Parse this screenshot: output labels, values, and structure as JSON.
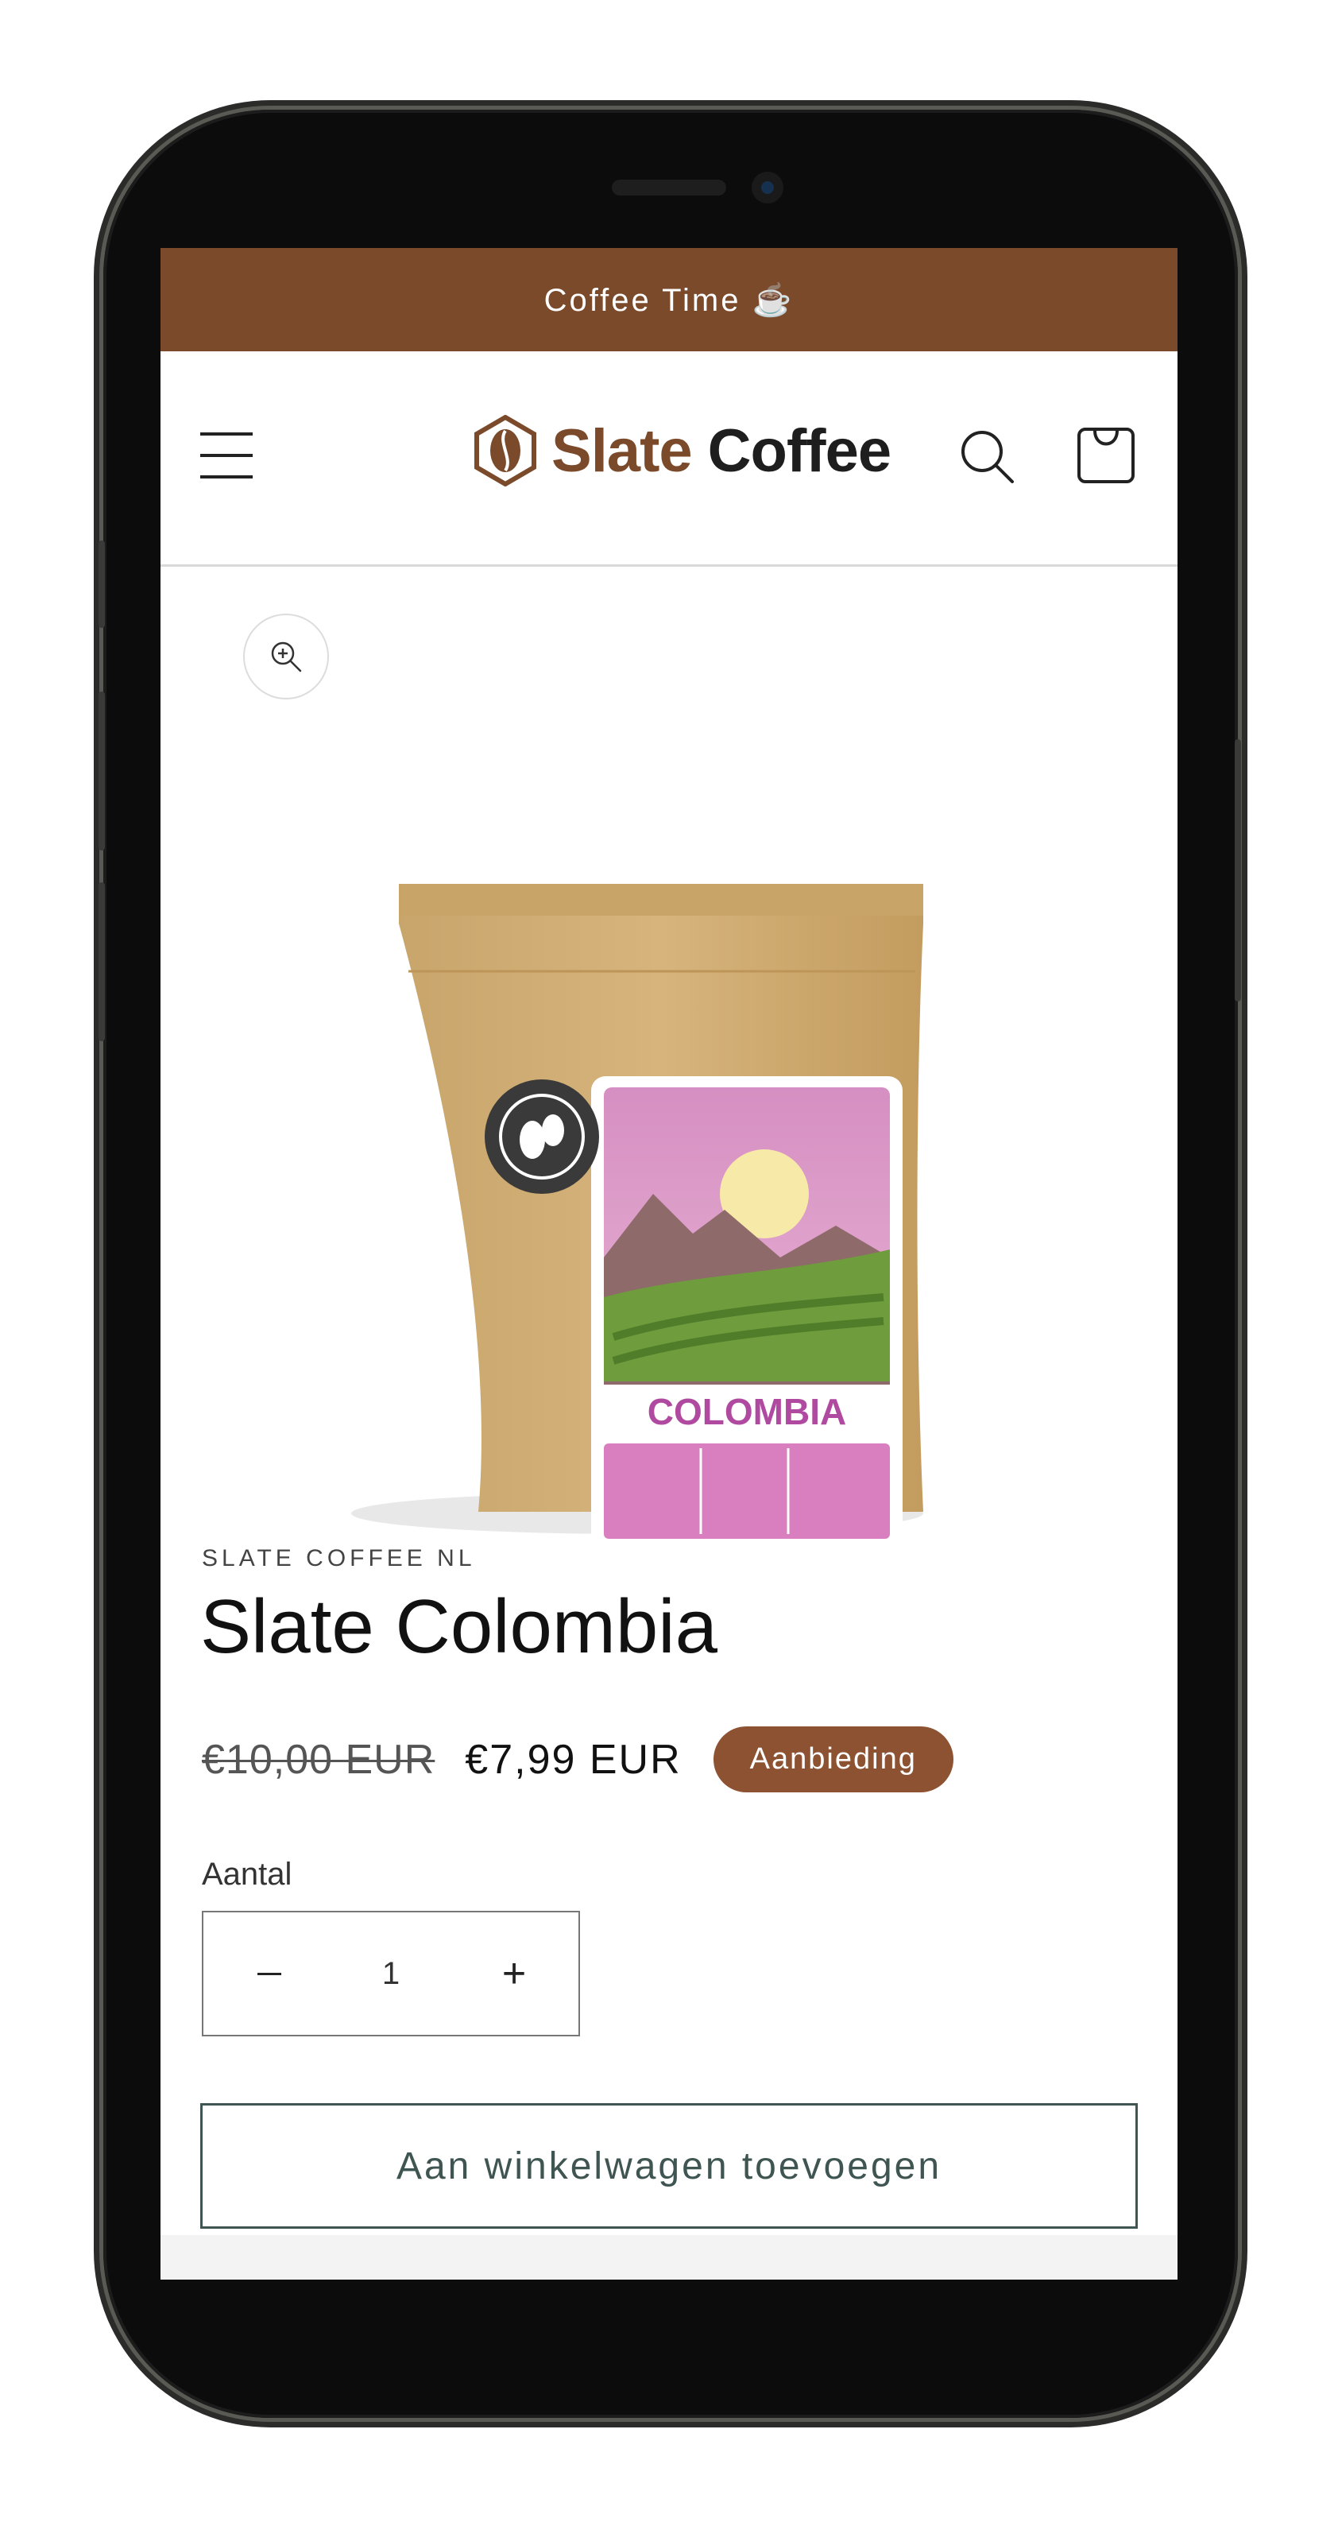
{
  "announcement": {
    "text": "Coffee Time ☕"
  },
  "header": {
    "logo_word1": "Slate",
    "logo_word2": "Coffee",
    "menu_icon": "hamburger-icon",
    "search_icon": "search-icon",
    "cart_icon": "bag-icon"
  },
  "product": {
    "zoom_icon": "zoom-in-icon",
    "image_label": "COLOMBIA",
    "vendor": "SLATE COFFEE NL",
    "title": "Slate Colombia",
    "old_price": "€10,00 EUR",
    "new_price": "€7,99 EUR",
    "badge": "Aanbieding"
  },
  "quantity": {
    "label": "Aantal",
    "value": "1",
    "minus_icon": "minus-icon",
    "plus_label": "+"
  },
  "actions": {
    "add_to_cart": "Aan winkelwagen toevoegen"
  },
  "colors": {
    "announcement_bg": "#7a4a2a",
    "badge_bg": "#8c5232",
    "button_border": "#3f5552"
  }
}
